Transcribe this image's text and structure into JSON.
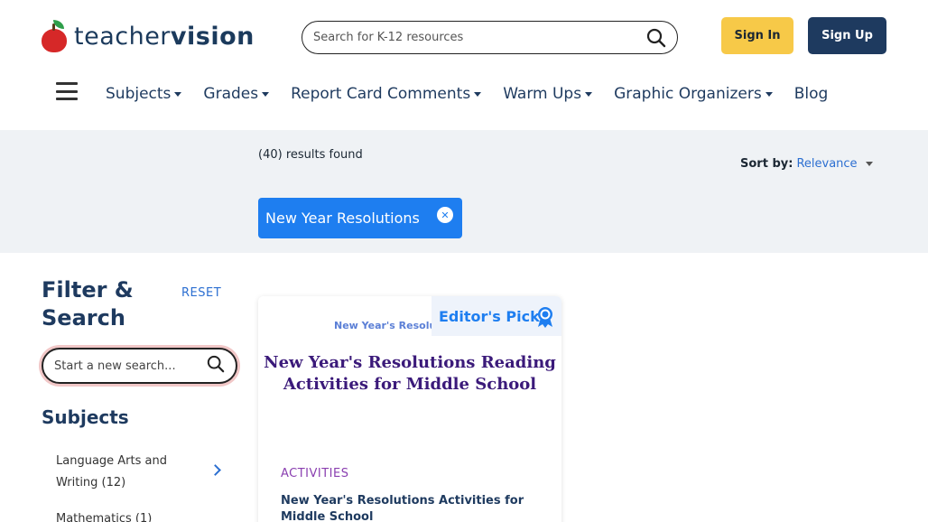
{
  "header": {
    "logo": {
      "part1": "teacher",
      "part2": "vision"
    },
    "search": {
      "placeholder": "Search for K-12 resources"
    },
    "sign_in": "Sign In",
    "sign_up": "Sign Up"
  },
  "nav": {
    "items": [
      {
        "label": "Subjects",
        "has_dropdown": true
      },
      {
        "label": "Grades",
        "has_dropdown": true
      },
      {
        "label": "Report Card Comments",
        "has_dropdown": true
      },
      {
        "label": "Warm Ups",
        "has_dropdown": true
      },
      {
        "label": "Graphic Organizers",
        "has_dropdown": true
      },
      {
        "label": "Blog",
        "has_dropdown": false
      }
    ]
  },
  "results": {
    "count_text": "(40) results found",
    "sort_label": "Sort by:",
    "sort_value": "Relevance",
    "active_filter": "New Year Resolutions"
  },
  "sidebar": {
    "title": "Filter & Search",
    "reset": "RESET",
    "search_placeholder": "Start a new search...",
    "subjects_title": "Subjects",
    "subjects": [
      {
        "label": "Language Arts and Writing (12)"
      },
      {
        "label": "Mathematics (1)"
      }
    ]
  },
  "card": {
    "image_subtitle": "New Year's Resolutions",
    "image_title": "New Year's Resolutions Reading Activities for Middle School",
    "badge": "Editor's Pick",
    "category": "ACTIVITIES",
    "title": "New Year's Resolutions Activities for Middle School"
  },
  "colors": {
    "brand_navy": "#1e3a5f",
    "accent_blue": "#1e7ef0",
    "sign_in_yellow": "#f7c948",
    "category_purple": "#8a3fb0"
  }
}
